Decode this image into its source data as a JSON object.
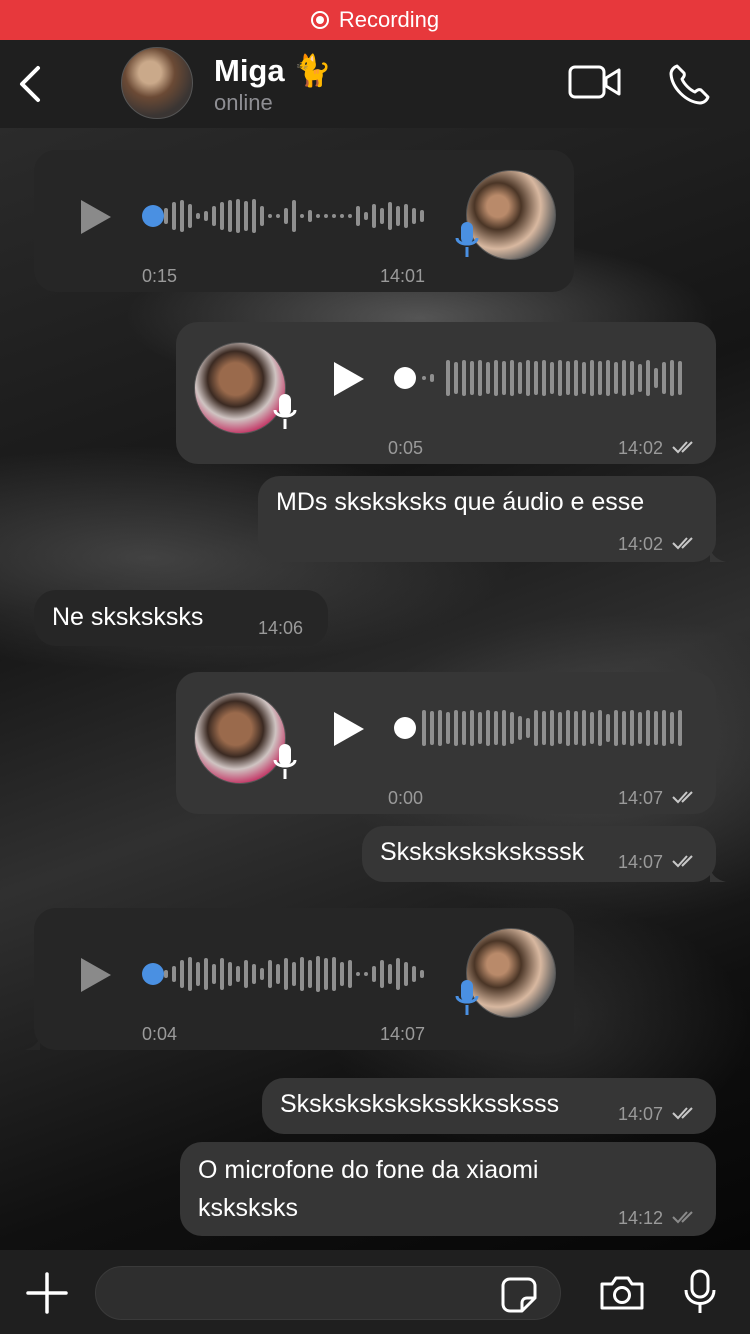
{
  "recording_bar": {
    "label": "Recording",
    "color": "#e7383c"
  },
  "header": {
    "contact_name": "Miga 🐈",
    "status": "online"
  },
  "icons": {
    "back": "chevron-left-icon",
    "video": "video-camera-icon",
    "call": "phone-icon",
    "plus": "plus-icon",
    "sticker": "sticker-icon",
    "camera": "camera-icon",
    "mic": "microphone-icon"
  },
  "accent": "#4a90e2",
  "messages": [
    {
      "type": "voice",
      "direction": "in",
      "duration": "0:15",
      "time": "14:01"
    },
    {
      "type": "voice",
      "direction": "out",
      "duration": "0:05",
      "time": "14:02"
    },
    {
      "type": "text",
      "direction": "out",
      "text": "MDs sksksksks que áudio e esse",
      "time": "14:02"
    },
    {
      "type": "text",
      "direction": "in",
      "text": "Ne sksksksks",
      "time": "14:06"
    },
    {
      "type": "voice",
      "direction": "out",
      "duration": "0:00",
      "time": "14:07"
    },
    {
      "type": "text",
      "direction": "out",
      "text": "Sksksksksksksssk",
      "time": "14:07"
    },
    {
      "type": "voice",
      "direction": "in",
      "duration": "0:04",
      "time": "14:07"
    },
    {
      "type": "text",
      "direction": "out",
      "text": "Sksksksksksksskkssksss",
      "time": "14:07"
    },
    {
      "type": "text",
      "direction": "out",
      "text_line1": "O microfone do fone da xiaomi",
      "text_line2": "ksksksks",
      "time": "14:12"
    }
  ]
}
